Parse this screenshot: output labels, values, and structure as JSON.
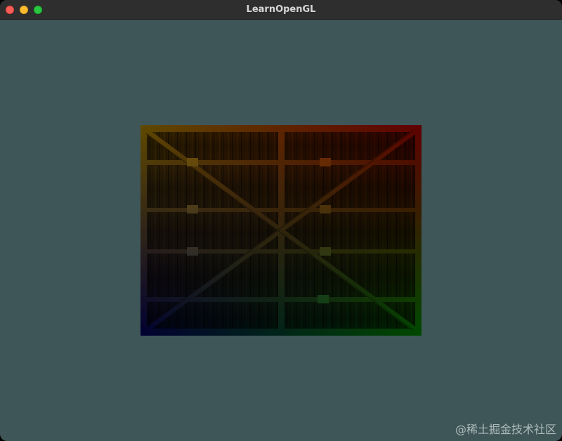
{
  "window": {
    "title": "LearnOpenGL",
    "background_color": "#3f5658"
  },
  "traffic_lights": {
    "close_color": "#ff5f57",
    "minimize_color": "#febc2e",
    "maximize_color": "#28c840"
  },
  "render": {
    "object": "textured-quad",
    "texture": "wooden-container",
    "vertex_colors": {
      "top_left": "#ffff00",
      "top_right": "#ff0000",
      "bottom_left": "#0000ff",
      "bottom_right": "#00ff00"
    }
  },
  "watermark": {
    "text": "@稀土掘金技术社区"
  }
}
